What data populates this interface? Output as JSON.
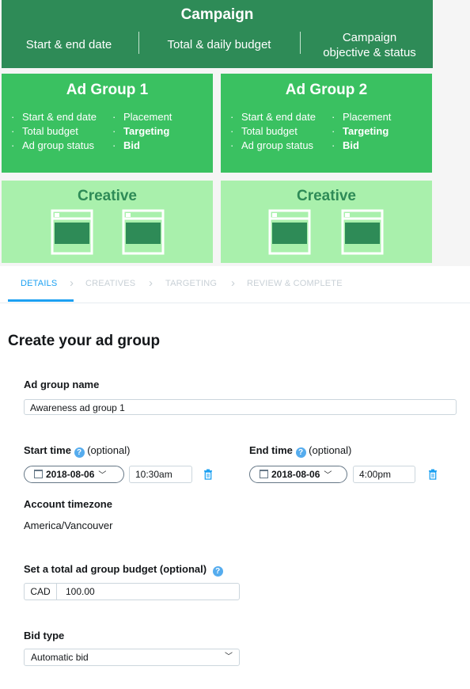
{
  "diagram": {
    "campaign": {
      "title": "Campaign",
      "items": [
        "Start & end date",
        "Total & daily budget",
        "Campaign\nobjective & status"
      ]
    },
    "ad_groups": [
      {
        "title": "Ad Group 1",
        "left_items": [
          "Start & end date",
          "Total budget",
          "Ad group status"
        ],
        "right_items": [
          "Placement",
          "Targeting",
          "Bid"
        ]
      },
      {
        "title": "Ad Group 2",
        "left_items": [
          "Start & end date",
          "Total budget",
          "Ad group status"
        ],
        "right_items": [
          "Placement",
          "Targeting",
          "Bid"
        ]
      }
    ],
    "creative_title": "Creative",
    "colors": {
      "campaign": "#2e8b57",
      "ad_group": "#3ac161",
      "creative": "#a9f0ac"
    }
  },
  "steps": [
    {
      "label": "DETAILS",
      "active": true
    },
    {
      "label": "CREATIVES",
      "active": false
    },
    {
      "label": "TARGETING",
      "active": false
    },
    {
      "label": "REVIEW & COMPLETE",
      "active": false
    }
  ],
  "form": {
    "page_title": "Create your ad group",
    "ad_group_name": {
      "label": "Ad group name",
      "value": "Awareness ad group 1"
    },
    "start_time": {
      "label": "Start time",
      "optional": "(optional)",
      "date": "2018-08-06",
      "time": "10:30am"
    },
    "end_time": {
      "label": "End time",
      "optional": "(optional)",
      "date": "2018-08-06",
      "time": "4:00pm"
    },
    "timezone": {
      "label": "Account timezone",
      "value": "America/Vancouver"
    },
    "budget": {
      "label": "Set a total ad group budget (optional)",
      "currency": "CAD",
      "amount": "100.00"
    },
    "bid_type": {
      "label": "Bid type",
      "value": "Automatic bid"
    },
    "accent": "#1da1f2"
  }
}
